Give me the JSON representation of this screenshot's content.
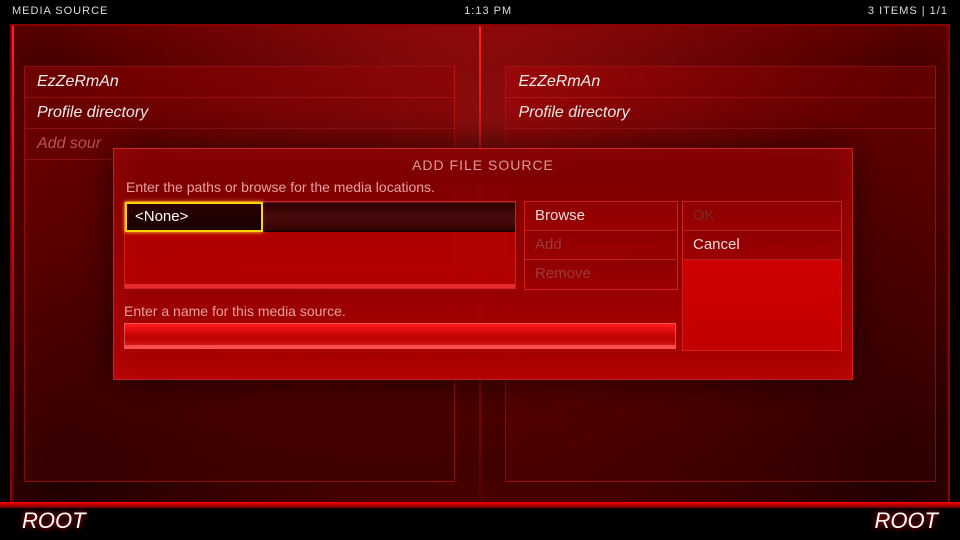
{
  "topbar": {
    "left": "MEDIA SOURCE",
    "center": "1:13 PM",
    "right": "3 ITEMS | 1/1"
  },
  "background": {
    "left_items": [
      "EzZeRmAn",
      "Profile directory",
      "Add sour"
    ],
    "right_items": [
      "EzZeRmAn",
      "Profile directory"
    ]
  },
  "dialog": {
    "title": "ADD FILE SOURCE",
    "paths_prompt": "Enter the paths or browse for the media locations.",
    "path_value": "<None>",
    "browse": "Browse",
    "add": "Add",
    "remove": "Remove",
    "ok": "OK",
    "cancel": "Cancel",
    "name_prompt": "Enter a name for this media source.",
    "name_value": ""
  },
  "footer": {
    "left": "ROOT",
    "right": "ROOT"
  },
  "colors": {
    "accent": "#ff0000",
    "highlight_border": "#ffd400"
  }
}
